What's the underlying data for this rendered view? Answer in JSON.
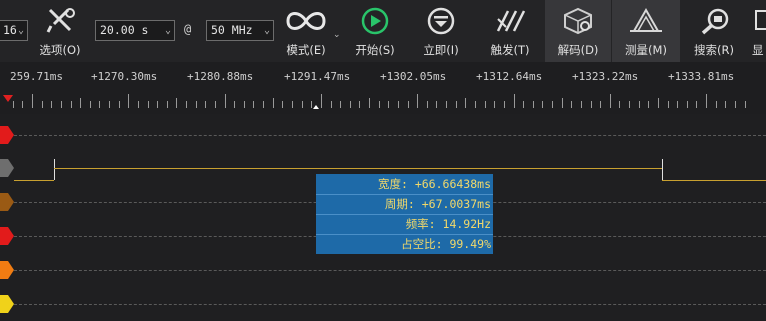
{
  "toolbar": {
    "channel_select": "16",
    "duration_select": "20.00 s",
    "at_symbol": "@",
    "rate_select": "50 MHz",
    "options_label": "选项(O)",
    "mode_label": "模式(E)",
    "start_label": "开始(S)",
    "immediate_label": "立即(I)",
    "trigger_label": "触发(T)",
    "decode_label": "解码(D)",
    "measure_label": "测量(M)",
    "search_label": "搜索(R)",
    "display_label": "显"
  },
  "ruler": {
    "labels": [
      "259.71ms",
      "+1270.30ms",
      "+1280.88ms",
      "+1291.47ms",
      "+1302.05ms",
      "+1312.64ms",
      "+1323.22ms",
      "+1333.81ms"
    ]
  },
  "measurement": {
    "width": "宽度: +66.66438ms",
    "period": "周期: +67.0037ms",
    "frequency": "频率: 14.92Hz",
    "duty": "占空比: 99.49%"
  },
  "colors": {
    "ch0": "#e21b1b",
    "ch1": "#6e6e6e",
    "ch2": "#9a5a14",
    "ch3": "#e21b1b",
    "ch4": "#f07c12",
    "ch5": "#f0d21a",
    "tooltip_bg": "#1e6aa8",
    "tooltip_text": "#f2d96a",
    "start_green": "#29c46a"
  }
}
